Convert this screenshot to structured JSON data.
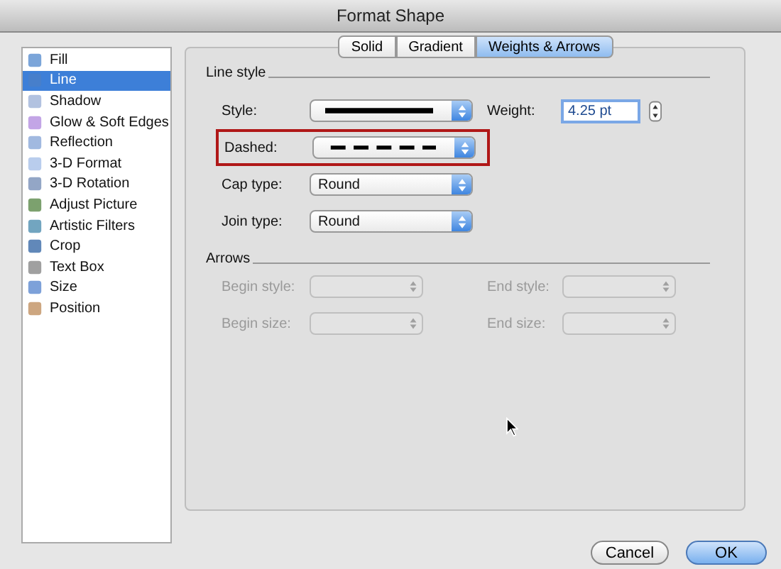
{
  "window": {
    "title": "Format Shape"
  },
  "sidebar": {
    "items": [
      {
        "label": "Fill",
        "selected": false
      },
      {
        "label": "Line",
        "selected": true
      },
      {
        "label": "Shadow",
        "selected": false
      },
      {
        "label": "Glow & Soft Edges",
        "selected": false
      },
      {
        "label": "Reflection",
        "selected": false
      },
      {
        "label": "3-D Format",
        "selected": false
      },
      {
        "label": "3-D Rotation",
        "selected": false
      },
      {
        "label": "Adjust Picture",
        "selected": false
      },
      {
        "label": "Artistic Filters",
        "selected": false
      },
      {
        "label": "Crop",
        "selected": false
      },
      {
        "label": "Text Box",
        "selected": false
      },
      {
        "label": "Size",
        "selected": false
      },
      {
        "label": "Position",
        "selected": false
      }
    ]
  },
  "tabs": [
    {
      "label": "Solid",
      "selected": false
    },
    {
      "label": "Gradient",
      "selected": false
    },
    {
      "label": "Weights & Arrows",
      "selected": true
    }
  ],
  "line_style": {
    "heading": "Line style",
    "style": {
      "label": "Style:",
      "kind": "solid"
    },
    "weight": {
      "label": "Weight:",
      "value": "4.25 pt"
    },
    "dashed": {
      "label": "Dashed:",
      "kind": "dash",
      "highlighted": true
    },
    "cap_type": {
      "label": "Cap type:",
      "value": "Round"
    },
    "join_type": {
      "label": "Join type:",
      "value": "Round"
    }
  },
  "arrows": {
    "heading": "Arrows",
    "fields": [
      {
        "label": "Begin style:",
        "disabled": true
      },
      {
        "label": "End style:",
        "disabled": true
      },
      {
        "label": "Begin size:",
        "disabled": true
      },
      {
        "label": "End size:",
        "disabled": true
      }
    ]
  },
  "buttons": [
    {
      "label": "Cancel",
      "default": false
    },
    {
      "label": "OK",
      "default": true
    }
  ]
}
